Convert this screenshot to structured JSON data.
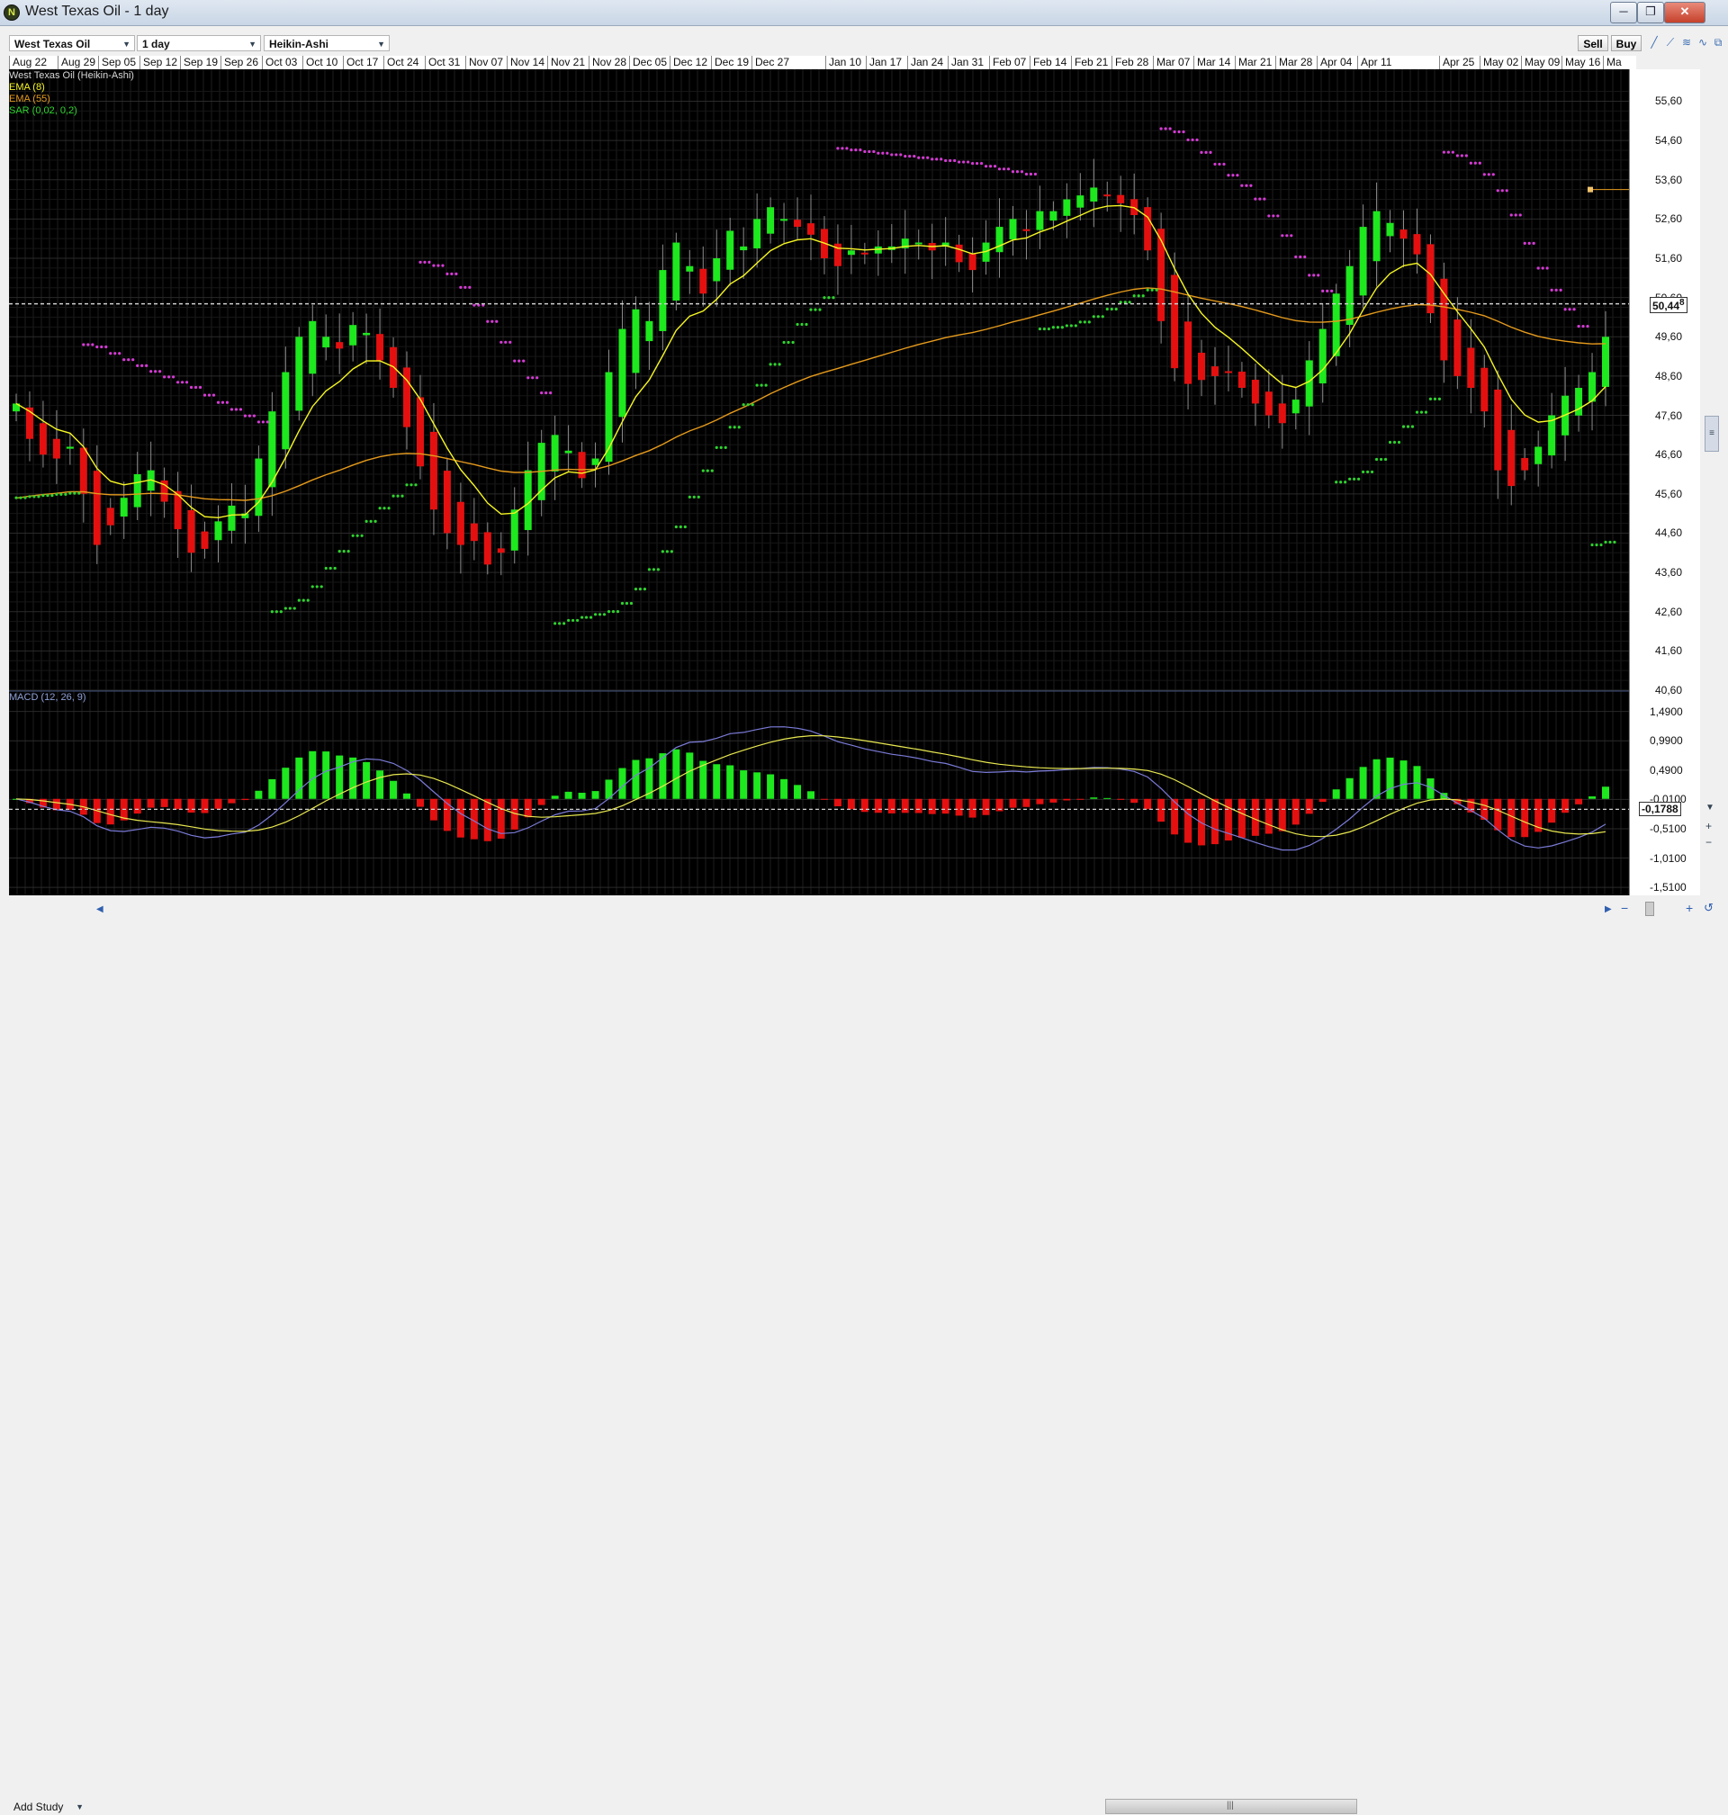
{
  "window": {
    "title": "West Texas Oil - 1 day",
    "minimize": "─",
    "restore": "❐",
    "close": "✕"
  },
  "toolbar": {
    "instrument": "West Texas Oil",
    "interval": "1 day",
    "chart_style": "Heikin-Ashi",
    "sell_label": "Sell",
    "buy_label": "Buy"
  },
  "legend": {
    "main": "West Texas Oil (Heikin-Ashi)",
    "ema8": "EMA (8)",
    "ema55": "EMA (55)",
    "sar": "SAR (0,02, 0,2)",
    "macd": "MACD (12, 26, 9)"
  },
  "colors": {
    "up": "#1ee81e",
    "down": "#e41010",
    "ema8": "#f5f523",
    "ema55": "#e59a1c",
    "sar_up": "#2ed42e",
    "sar_down": "#d63ad6",
    "macd_line": "#7b7bd9",
    "signal_line": "#e8e850"
  },
  "dates": [
    "Aug 22",
    "Aug 29",
    "Sep 05",
    "Sep 12",
    "Sep 19",
    "Sep 26",
    "Oct 03",
    "Oct 10",
    "Oct 17",
    "Oct 24",
    "Oct 31",
    "Nov 07",
    "Nov 14",
    "Nov 21",
    "Nov 28",
    "Dec 05",
    "Dec 12",
    "Dec 19",
    "Dec 27",
    "Jan 10",
    "Jan 17",
    "Jan 24",
    "Jan 31",
    "Feb 07",
    "Feb 14",
    "Feb 21",
    "Feb 28",
    "Mar 07",
    "Mar 14",
    "Mar 21",
    "Mar 28",
    "Apr 04",
    "Apr 11",
    "Apr 25",
    "May 02",
    "May 09",
    "May 16",
    "Ma"
  ],
  "price_axis": {
    "ticks": [
      "55,60",
      "54,60",
      "53,60",
      "52,60",
      "51,60",
      "50,60",
      "49,60",
      "48,60",
      "47,60",
      "46,60",
      "45,60",
      "44,60",
      "43,60",
      "42,60",
      "41,60",
      "40,60"
    ],
    "current": "50,44",
    "current_suffix": "8"
  },
  "macd_axis": {
    "ticks": [
      "1,4900",
      "0,9900",
      "0,4900",
      "-0,0100",
      "-0,5100",
      "-1,0100",
      "-1,5100"
    ],
    "current": "-0,1788"
  },
  "bottom": {
    "add_study": "Add Study"
  },
  "chart_data": {
    "type": "line",
    "title": "West Texas Oil - 1 day",
    "xlabel": "",
    "ylabel": "",
    "price_ylim": [
      40.6,
      56.0
    ],
    "current_price": 50.44,
    "marker_price": 53.35,
    "macd_ylim": [
      -1.6,
      1.7
    ],
    "macd_current": -0.1788,
    "grid": true,
    "series": [
      {
        "name": "West Texas Oil (Heikin-Ashi)",
        "style": "heikin-ashi candles",
        "close": [
          47.9,
          47.0,
          46.6,
          46.5,
          46.8,
          45.6,
          44.3,
          44.8,
          45.5,
          46.1,
          46.2,
          45.4,
          44.7,
          44.1,
          44.2,
          44.9,
          45.3,
          45.1,
          46.5,
          47.7,
          48.7,
          49.6,
          50.0,
          49.6,
          49.3,
          49.9,
          49.7,
          49.0,
          48.3,
          47.3,
          46.3,
          45.2,
          44.6,
          44.3,
          44.4,
          43.8,
          44.1,
          45.2,
          46.2,
          46.9,
          47.1,
          46.7,
          46.0,
          46.5,
          48.7,
          49.8,
          50.3,
          50.0,
          51.3,
          52.0,
          51.4,
          50.7,
          51.6,
          52.3,
          51.9,
          52.6,
          52.9,
          52.6,
          52.4,
          52.2,
          51.6,
          51.4,
          51.8,
          51.7,
          51.9,
          51.9,
          52.1,
          52.0,
          51.8,
          52.0,
          51.5,
          51.3,
          52.0,
          52.4,
          52.6,
          52.3,
          52.8,
          52.8,
          53.1,
          53.2,
          53.4,
          53.2,
          53.0,
          52.7,
          51.8,
          50.0,
          48.8,
          48.4,
          48.5,
          48.6,
          48.7,
          48.3,
          47.9,
          47.6,
          47.4,
          48.0,
          49.0,
          49.8,
          50.7,
          51.4,
          52.4,
          52.8,
          52.5,
          52.1,
          51.7,
          50.2,
          49.0,
          48.6,
          48.3,
          47.7,
          46.2,
          45.8,
          46.2,
          46.8,
          47.6,
          48.1,
          48.3,
          48.7,
          49.6
        ],
        "ema8_last": 48.7,
        "ema55_last": 49.3
      },
      {
        "name": "MACD (12, 26, 9)",
        "histogram_last": 0.55,
        "signal_last": -0.42
      }
    ]
  }
}
